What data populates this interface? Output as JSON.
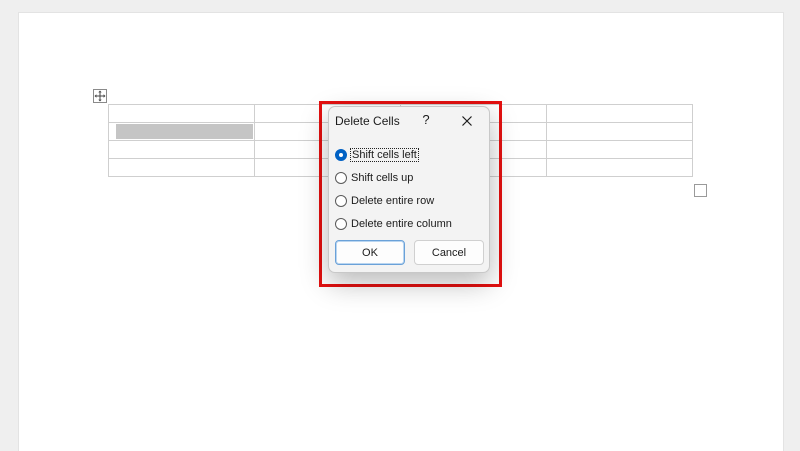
{
  "dialog": {
    "title": "Delete Cells",
    "help_label": "?",
    "close_icon": "close-icon",
    "options": [
      {
        "label": "Shift cells left",
        "selected": true
      },
      {
        "label": "Shift cells up",
        "selected": false
      },
      {
        "label": "Delete entire row",
        "selected": false
      },
      {
        "label": "Delete entire column",
        "selected": false
      }
    ],
    "ok_label": "OK",
    "cancel_label": "Cancel"
  },
  "document": {
    "table_rows": 4,
    "table_columns": 4,
    "move_handle_icon": "move-icon",
    "resize_handle_icon": "resize-handle-icon"
  },
  "colors": {
    "highlight": "#e41010",
    "radio_accent": "#0061c4",
    "selected_cell": "#c5c5c5"
  }
}
